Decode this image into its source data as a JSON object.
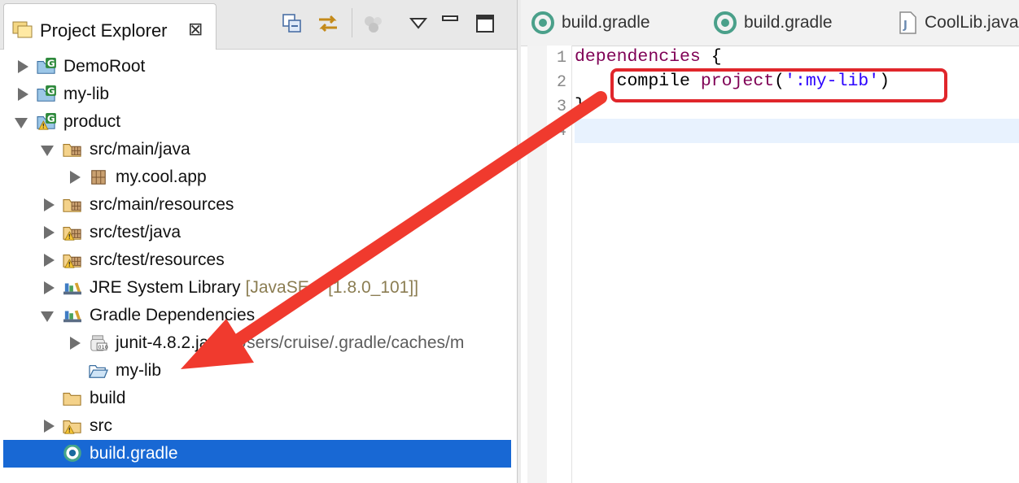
{
  "explorer": {
    "title": "Project Explorer",
    "close_symbol": "⊠",
    "toolbar": [
      "collapse-all-icon",
      "link-with-editor-icon",
      "focus-icon",
      "view-menu-icon",
      "minimize-icon",
      "maximize-icon"
    ],
    "tree": [
      {
        "label": "DemoRoot",
        "indent": 0,
        "state": "closed",
        "icon": "gradle-project-icon"
      },
      {
        "label": "my-lib",
        "indent": 0,
        "state": "closed",
        "icon": "gradle-project-icon"
      },
      {
        "label": "product",
        "indent": 0,
        "state": "open",
        "icon": "gradle-project-warning-icon"
      },
      {
        "label": "src/main/java",
        "indent": 1,
        "state": "open",
        "icon": "source-folder-icon"
      },
      {
        "label": "my.cool.app",
        "indent": 2,
        "state": "closed",
        "icon": "package-icon"
      },
      {
        "label": "src/main/resources",
        "indent": 1,
        "state": "closed",
        "icon": "source-folder-icon"
      },
      {
        "label": "src/test/java",
        "indent": 1,
        "state": "closed",
        "icon": "source-folder-warning-icon"
      },
      {
        "label": "src/test/resources",
        "indent": 1,
        "state": "closed",
        "icon": "source-folder-warning-icon"
      },
      {
        "label": "JRE System Library",
        "decoration": "[JavaSE 8 [1.8.0_101]]",
        "indent": 1,
        "state": "closed",
        "icon": "library-icon"
      },
      {
        "label": "Gradle Dependencies",
        "indent": 1,
        "state": "open",
        "icon": "library-icon"
      },
      {
        "label": "junit-4.8.2.jar",
        "decoration": " - /Users/cruise/.gradle/caches/m",
        "indent": 2,
        "state": "closed",
        "icon": "jar-icon"
      },
      {
        "label": "my-lib",
        "indent": 2,
        "state": "none",
        "icon": "open-folder-icon"
      },
      {
        "label": "build",
        "indent": 1,
        "state": "none",
        "icon": "folder-icon"
      },
      {
        "label": "src",
        "indent": 1,
        "state": "closed",
        "icon": "folder-warning-icon"
      },
      {
        "label": "build.gradle",
        "indent": 1,
        "state": "none",
        "icon": "gradle-file-icon",
        "selected": true
      }
    ]
  },
  "editor": {
    "tabs": [
      {
        "label": "build.gradle",
        "icon": "gradle-file-icon"
      },
      {
        "label": "build.gradle",
        "icon": "gradle-file-icon"
      },
      {
        "label": "CoolLib.java",
        "icon": "java-file-icon"
      }
    ],
    "line_numbers": [
      "1",
      "2",
      "3",
      "4"
    ],
    "code": {
      "l1_kw": "dependencies",
      "l1_rest": " {",
      "l2_indent": "    ",
      "l2_compile": "compile ",
      "l2_kw": "project",
      "l2_open": "(",
      "l2_str": "':my-lib'",
      "l2_close": ")",
      "l3": "}"
    }
  },
  "colors": {
    "selection": "#1868d4",
    "annotation_red": "#e0262b",
    "keyword": "#7f0055",
    "string": "#2a00ff"
  }
}
